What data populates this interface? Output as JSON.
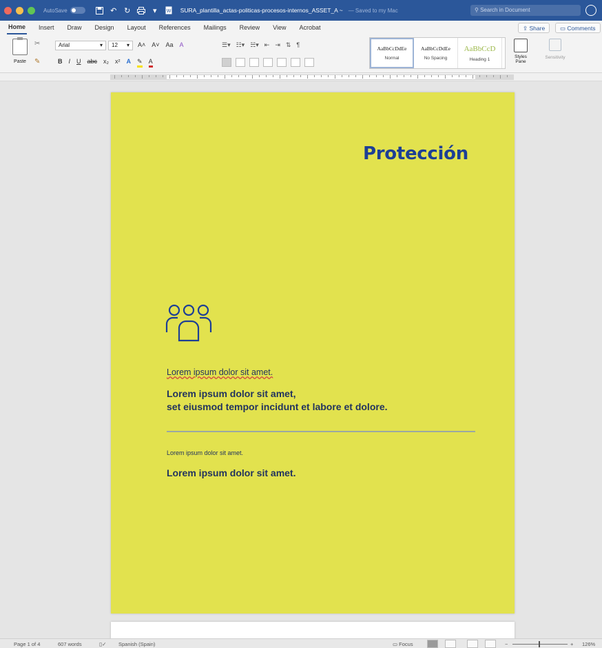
{
  "titlebar": {
    "autosave_label": "AutoSave",
    "autosave_state": "off",
    "document_name": "SURA_plantilla_actas-politicas-procesos-internos_ASSET_A ~",
    "saved_status": "— Saved to my Mac",
    "search_placeholder": "Search in Document",
    "icons": [
      "save-icon",
      "undo-icon",
      "redo-icon",
      "print-icon",
      "user-icon"
    ],
    "traffic_light_colors": [
      "#ed6a5e",
      "#f5bf4f",
      "#61c554"
    ]
  },
  "ribbon": {
    "tabs": [
      "Home",
      "Insert",
      "Draw",
      "Design",
      "Layout",
      "References",
      "Mailings",
      "Review",
      "View",
      "Acrobat"
    ],
    "active_tab": "Home",
    "share_label": "Share",
    "comments_label": "Comments",
    "paste_label": "Paste",
    "font_name": "Arial",
    "font_size": "12",
    "format_buttons": [
      "B",
      "I",
      "U",
      "abc",
      "x₂",
      "x²"
    ],
    "font_case_buttons": [
      "A˄",
      "A˅",
      "Aa",
      "A"
    ],
    "styles": [
      {
        "sample": "AaBbCcDdEe",
        "name": "Normal"
      },
      {
        "sample": "AaBbCcDdEe",
        "name": "No Spacing"
      },
      {
        "sample": "AaBbCcD",
        "name": "Heading 1"
      }
    ],
    "styles_pane_label": "Styles Pane",
    "sensitivity_label": "Sensitivity"
  },
  "document": {
    "title": "Protección",
    "icon": "people-group-icon",
    "line_small": "Lorem ipsum dolor sit amet.",
    "bold_line_1": "Lorem ipsum dolor sit amet,",
    "bold_line_2": "set eiusmod tempor incidunt et labore et dolore.",
    "line_tiny": "Lorem ipsum dolor sit amet.",
    "bold_line_3": "Lorem ipsum dolor sit amet.",
    "page_color": "#e2e24e",
    "title_color": "#1d3f95"
  },
  "statusbar": {
    "page": "Page 1 of 4",
    "words": "607 words",
    "language": "Spanish (Spain)",
    "focus": "Focus",
    "zoom": "126%"
  }
}
